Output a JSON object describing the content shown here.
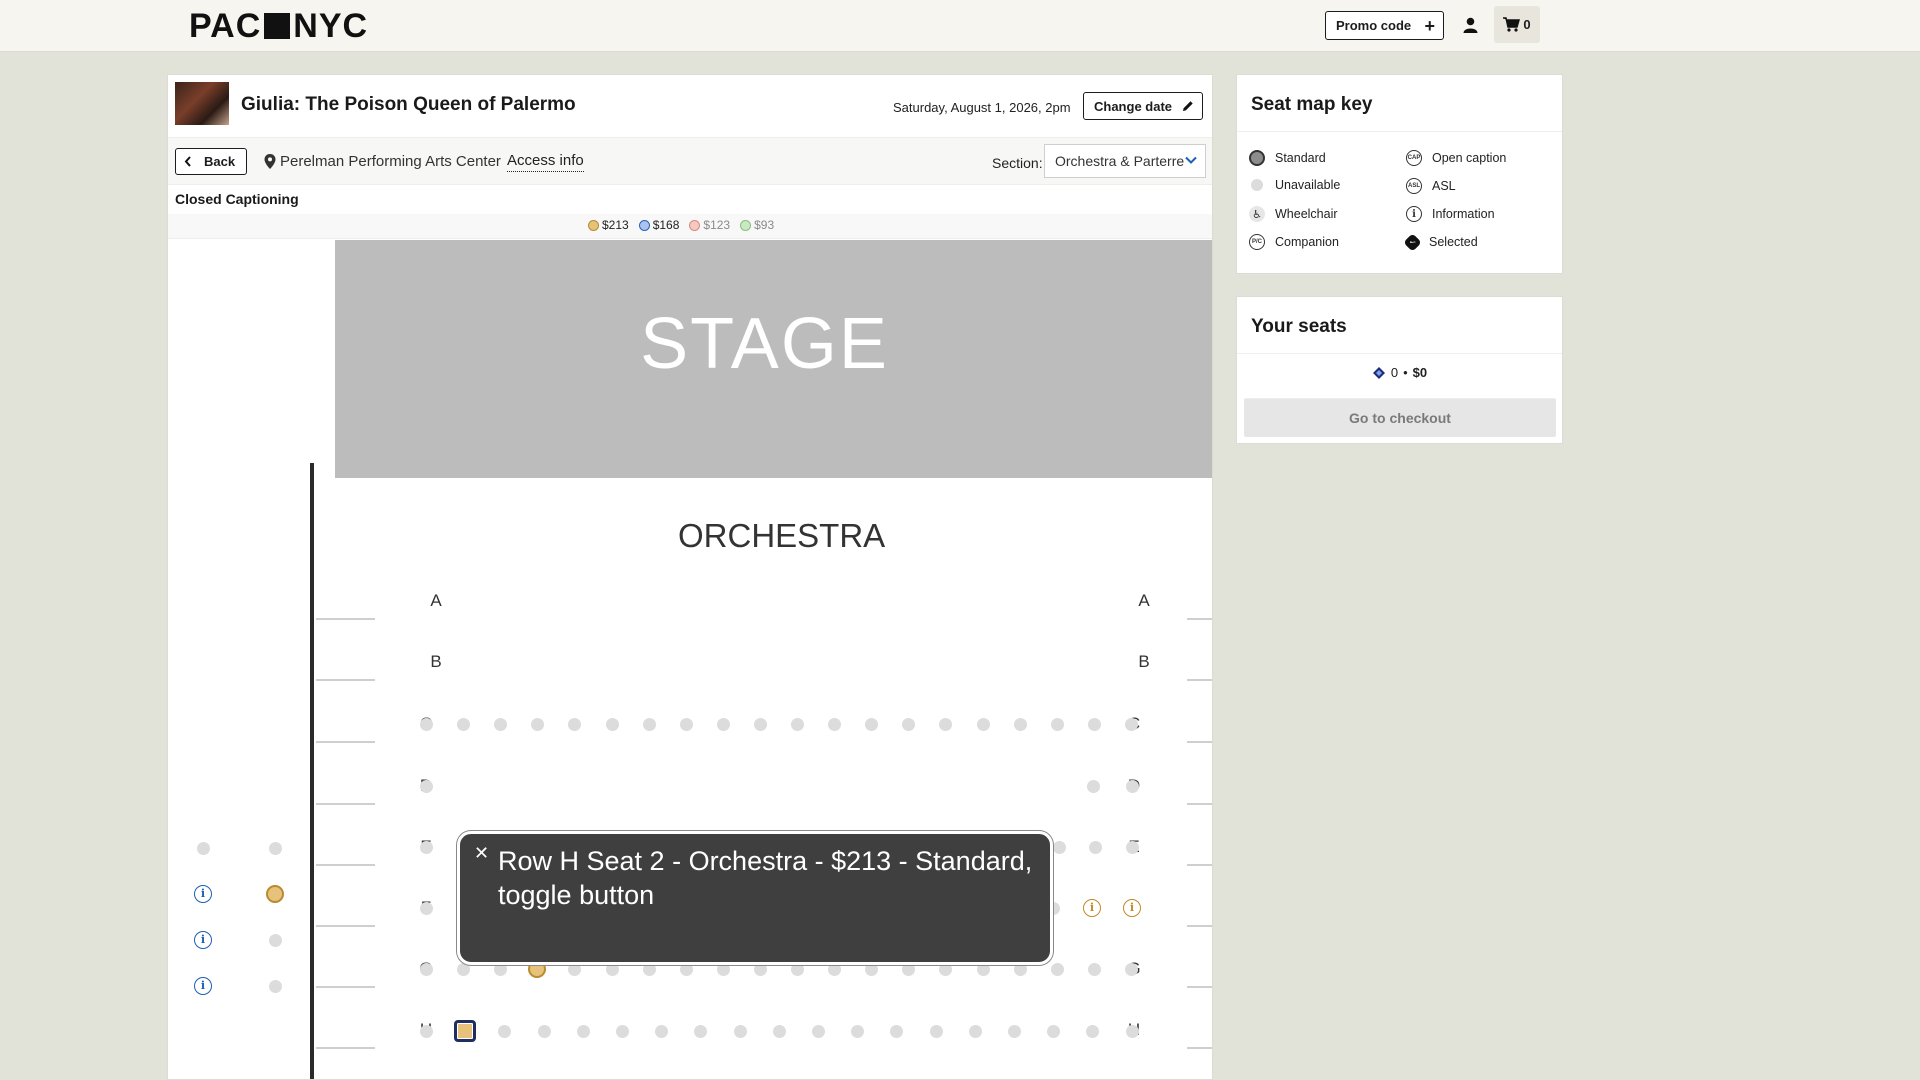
{
  "header": {
    "logo_left": "PAC",
    "logo_right": "NYC",
    "promo_label": "Promo code",
    "cart_count": "0",
    "icons": [
      "user-icon",
      "cart-icon",
      "plus-icon"
    ]
  },
  "show": {
    "title": "Giulia: The Poison Queen of Palermo",
    "date": "Saturday, August 1, 2026, 2pm",
    "change_date_label": "Change date",
    "back_label": "Back",
    "venue": "Perelman Performing Arts Center",
    "access_info": "Access info",
    "section_label": "Section:",
    "section_value": "Orchestra & Parterre",
    "captioning": "Closed Captioning"
  },
  "price_legend": [
    {
      "label": "$213",
      "color": "#e6c27a",
      "border": "#b98a2e"
    },
    {
      "label": "$168",
      "color": "#a9c4ef",
      "border": "#2f5fb8"
    },
    {
      "label": "$123",
      "color": "#f4c9c2",
      "border": "#d98a7e"
    },
    {
      "label": "$93",
      "color": "#c9e8c4",
      "border": "#86c07c"
    }
  ],
  "seat_map": {
    "stage_label": "STAGE",
    "section_name": "ORCHESTRA",
    "rows": [
      "A",
      "B",
      "C",
      "D",
      "E",
      "F",
      "G",
      "H"
    ]
  },
  "tooltip": {
    "text": "Row H Seat 2 - Orchestra - $213 - Standard, toggle button"
  },
  "seat_key": {
    "title": "Seat map key",
    "items": [
      {
        "label": "Standard",
        "icon": "standard-seat-icon"
      },
      {
        "label": "Open caption",
        "icon": "open-caption-icon"
      },
      {
        "label": "Unavailable",
        "icon": "unavailable-seat-icon"
      },
      {
        "label": "ASL",
        "icon": "asl-icon"
      },
      {
        "label": "Wheelchair",
        "icon": "wheelchair-icon"
      },
      {
        "label": "Information",
        "icon": "information-icon"
      },
      {
        "label": "Companion",
        "icon": "companion-icon"
      },
      {
        "label": "Selected",
        "icon": "selected-seat-icon"
      }
    ]
  },
  "your_seats": {
    "title": "Your seats",
    "count": "0",
    "total": "$0",
    "checkout_label": "Go to checkout"
  }
}
